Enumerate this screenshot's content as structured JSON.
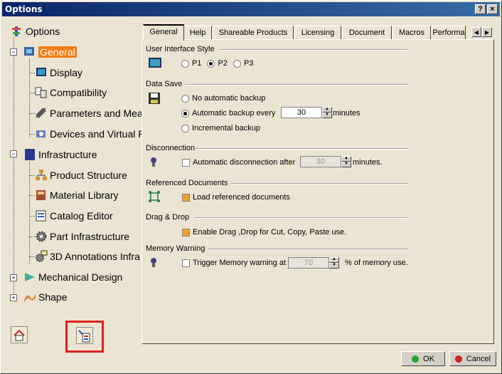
{
  "window": {
    "title": "Options",
    "help_label": "?",
    "close_label": "×"
  },
  "tree": {
    "root": "Options",
    "items": [
      {
        "label": "General",
        "selected": true
      },
      {
        "label": "Display"
      },
      {
        "label": "Compatibility"
      },
      {
        "label": "Parameters and Mea"
      },
      {
        "label": "Devices and Virtual R"
      },
      {
        "label": "Infrastructure"
      },
      {
        "label": "Product Structure"
      },
      {
        "label": "Material Library"
      },
      {
        "label": "Catalog Editor"
      },
      {
        "label": "Part Infrastructure"
      },
      {
        "label": "3D Annotations Infra"
      },
      {
        "label": "Mechanical Design"
      },
      {
        "label": "Shape"
      }
    ]
  },
  "tabs": [
    {
      "label": "General",
      "active": true
    },
    {
      "label": "Help"
    },
    {
      "label": "Shareable Products"
    },
    {
      "label": "Licensing"
    },
    {
      "label": "Document"
    },
    {
      "label": "Macros"
    },
    {
      "label": "Performa"
    }
  ],
  "sections": {
    "ui_style": {
      "title": "User Interface Style",
      "options": [
        "P1",
        "P2",
        "P3"
      ],
      "selected": "P2"
    },
    "data_save": {
      "title": "Data Save",
      "no_backup": "No automatic backup",
      "auto_backup": "Automatic backup every",
      "auto_value": "30",
      "auto_unit": "minutes",
      "incremental": "Incremental backup",
      "selected": "Automatic backup every"
    },
    "disconnection": {
      "title": "Disconnection",
      "label": "Automatic disconnection after",
      "value": "30",
      "unit": "minutes.",
      "checked": false
    },
    "ref_docs": {
      "title": "Referenced Documents",
      "label": "Load referenced documents",
      "checked": true
    },
    "drag_drop": {
      "title": "Drag & Drop",
      "label": "Enable Drag ,Drop for Cut, Copy, Paste use.",
      "checked": true
    },
    "memory": {
      "title": "Memory Warning",
      "label": "Trigger Memory warning at",
      "value": "70",
      "unit": "% of memory use.",
      "checked": false
    }
  },
  "buttons": {
    "ok": "OK",
    "cancel": "Cancel"
  },
  "colors": {
    "selection": "#f07c10",
    "highlight_box": "#e02020",
    "title_bar": "#0a246a"
  }
}
